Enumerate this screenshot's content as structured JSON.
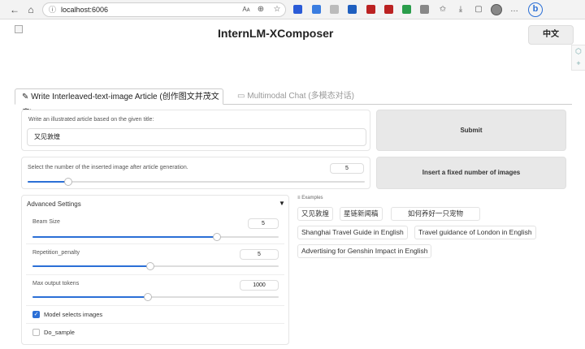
{
  "browser": {
    "url": "localhost:6006",
    "reader_label": "Aᴀ"
  },
  "page": {
    "title": "InternLM-XComposer",
    "lang_button": "中文"
  },
  "tabs": [
    {
      "label": "Write Interleaved-text-image Article (创作图文并茂文章)",
      "active": true
    },
    {
      "label": "Multimodal Chat (多模态对话)",
      "active": false
    }
  ],
  "article": {
    "title_label": "Write an illustrated article based on the given title:",
    "title_value": "又见敦煌",
    "submit_label": "Submit",
    "num_images_label": "Select the number of the inserted image after article generation.",
    "num_images_value": "5",
    "num_images_fraction": 0.12,
    "insert_button": "Insert a fixed number of images"
  },
  "advanced": {
    "header": "Advanced Settings",
    "toggle_icon": "▼",
    "beam_size": {
      "label": "Beam Size",
      "value": "5",
      "fraction": 0.75
    },
    "repetition_penalty": {
      "label": "Repetition_penalty",
      "value": "5",
      "fraction": 0.48
    },
    "max_output_tokens": {
      "label": "Max output tokens",
      "value": "1000",
      "fraction": 0.47
    },
    "model_selects_images": {
      "label": "Model selects images",
      "checked": true
    },
    "do_sample": {
      "label": "Do_sample",
      "checked": false
    }
  },
  "examples": {
    "label": "Examples",
    "items": [
      "又见敦煌",
      "星链新闻稿",
      "如何养好一只宠物",
      "Shanghai Travel Guide in English",
      "Travel guidance of London in English",
      "Advertising for Genshin Impact in English"
    ]
  },
  "colors": {
    "accent": "#2b6fd6",
    "button_bg": "#e8e8e8"
  }
}
